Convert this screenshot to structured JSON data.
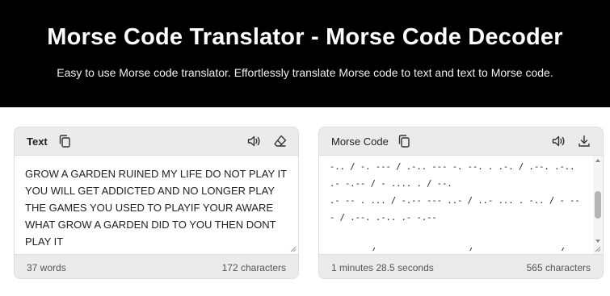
{
  "header": {
    "title": "Morse Code Translator - Morse Code Decoder",
    "subtitle": "Easy to use Morse code translator. Effortlessly translate Morse code to text and text to Morse code."
  },
  "text_panel": {
    "title": "Text",
    "content": "GROW A GARDEN RUINED MY LIFE DO NOT PLAY IT YOU WILL GET ADDICTED AND NO LONGER PLAY THE GAMES YOU USED TO PLAYIF YOUR AWARE WHAT GROW A GARDEN DID TO YOU THEN DONT PLAY IT",
    "word_count": "37 words",
    "char_count": "172 characters",
    "icons": [
      "copy-icon",
      "speaker-icon",
      "eraser-icon"
    ]
  },
  "morse_panel": {
    "title": "Morse Code",
    "content": "-.. / -. --- / .-.. --- -. --. . .-. / .--. .-.. .- -.-- / - .... . / --.\n.- -- . ... / -.-- --- ..- / ..- ... . -.. / - --- / .--. .-.. .- -.--\n\n.. ..-. / -.-- --- ..- .-. / .- .-- .- .-. . / .-- .... .- - / --. .-. ---\n.-- / .- / --. .- .-. -.. . -. / -.. .. -.. / - --- / -.-- --- ..- /\n- .... . -. / -.. --- -. - / .--. .-.. .- -.-- / .. -",
    "duration": "1 minutes 28.5 seconds",
    "char_count": "565 characters",
    "icons": [
      "copy-icon",
      "speaker-icon",
      "download-icon"
    ]
  }
}
